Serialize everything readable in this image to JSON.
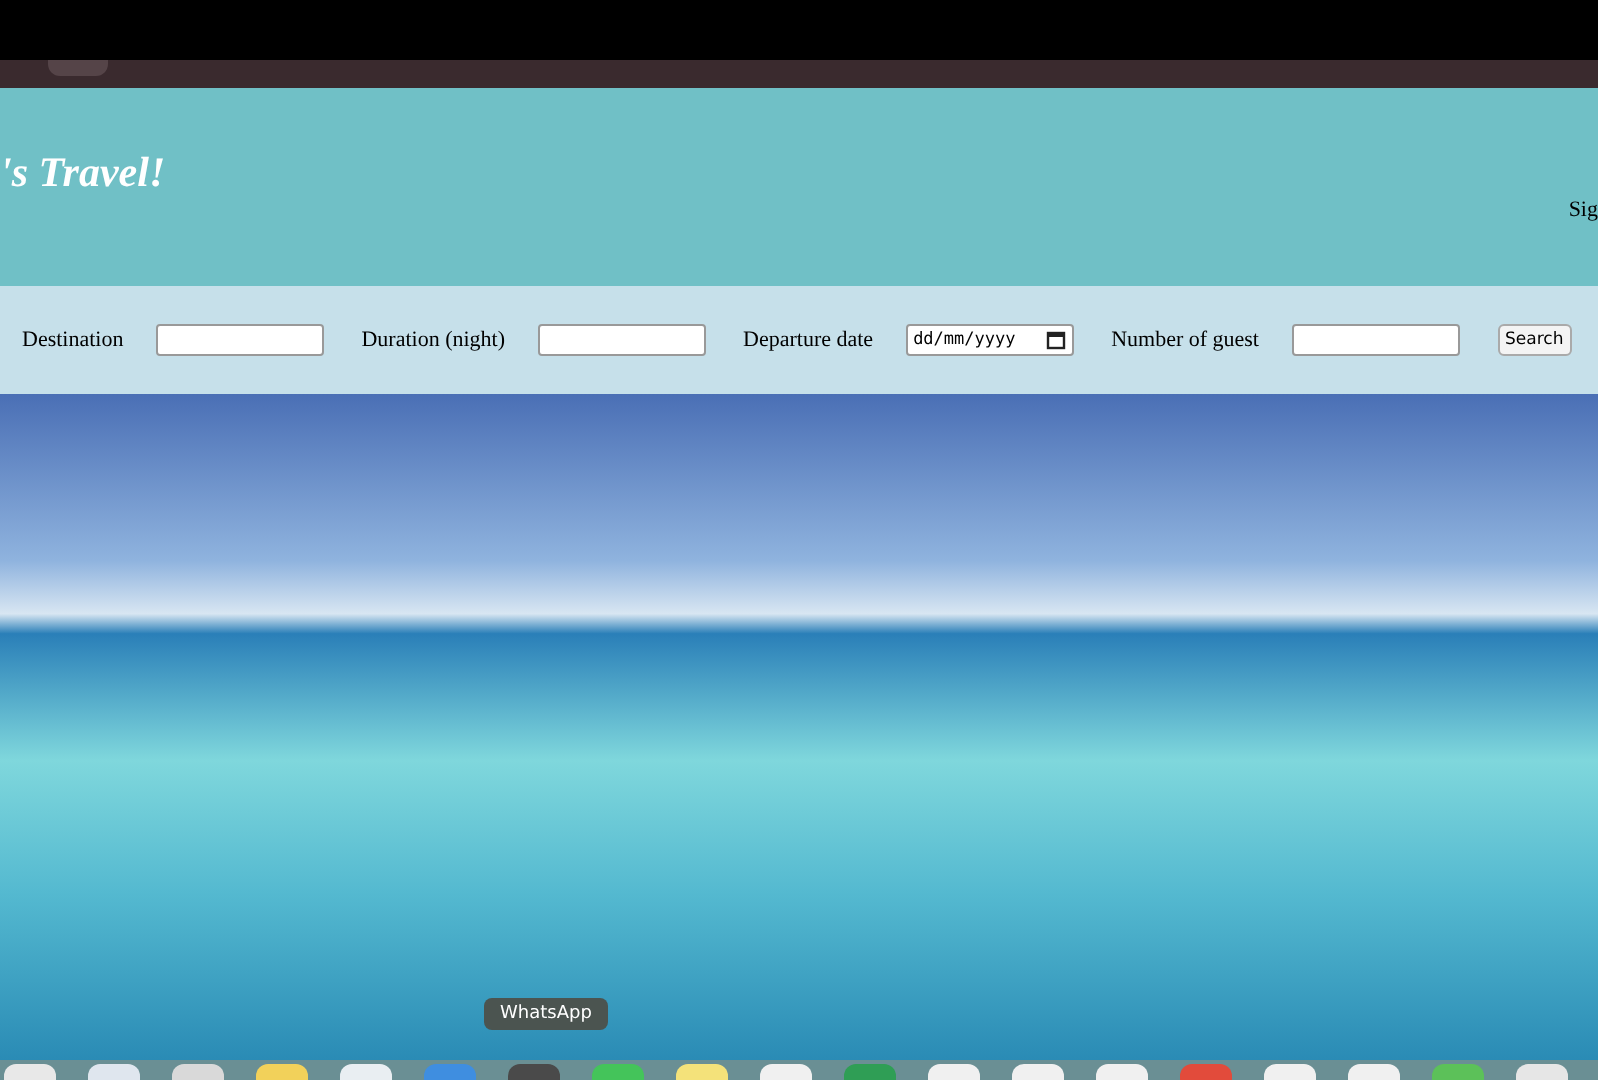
{
  "header": {
    "title": "'s Travel!",
    "link": "Sig"
  },
  "search_form": {
    "fields": [
      {
        "kind": "text",
        "label": "Destination"
      },
      {
        "kind": "text",
        "label": "Duration (night)"
      },
      {
        "kind": "date",
        "label": "Departure date",
        "placeholder": "dd/mm/yyyy"
      },
      {
        "kind": "text",
        "label": "Number of guest"
      }
    ],
    "button": "Search"
  },
  "dock": {
    "tooltip": "WhatsApp"
  }
}
